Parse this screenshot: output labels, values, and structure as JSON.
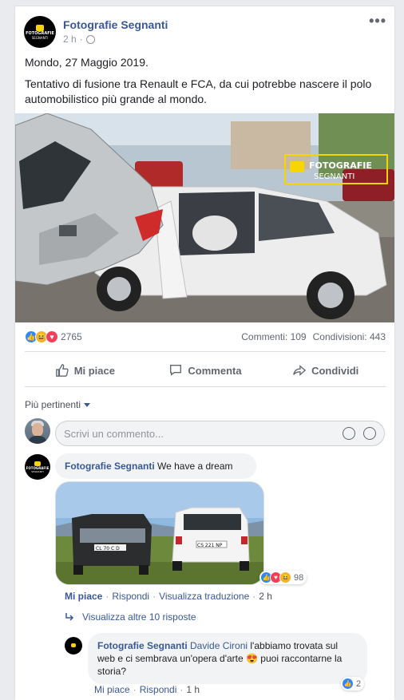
{
  "post": {
    "page_name": "Fotografie Segnanti",
    "time": "2 h",
    "date_line": "Mondo, 27 Maggio 2019.",
    "text": "Tentativo di fusione tra Renault e FCA, da cui potrebbe nascere il polo automobilistico più grande al mondo.",
    "logo_line1": "FOTOGRAFIE",
    "logo_line2": "SEGNANTI",
    "watermark_line1": "FOTOGRAFIE",
    "watermark_line2": "SEGNANTI"
  },
  "reactions": {
    "count": "2765",
    "comments": "Commenti: 109",
    "shares": "Condivisioni: 443",
    "icons": [
      "like-icon",
      "haha-icon",
      "love-icon"
    ]
  },
  "actions": {
    "like": "Mi piace",
    "comment": "Commenta",
    "share": "Condividi"
  },
  "comments": {
    "filter_label": "Più pertinenti",
    "input_placeholder": "Scrivi un commento...",
    "first": {
      "author": "Fotografie Segnanti",
      "text": "We have a dream",
      "like": "Mi piace",
      "reply": "Rispondi",
      "translate": "Visualizza traduzione",
      "time": "2 h",
      "reaction_count": "98",
      "plate_left": "CL 70 C D",
      "plate_right": "CS 221 NP"
    },
    "more_replies": "Visualizza altre 10 risposte",
    "reply": {
      "author": "Fotografie Segnanti",
      "mention": "Davide Cironi",
      "text": "l'abbiamo trovata sul web e ci sembrava un'opera d'arte 😍 puoi raccontarne la storia?",
      "like": "Mi piace",
      "reply": "Rispondi",
      "time": "1 h",
      "reaction_count": "2"
    }
  },
  "colors": {
    "link": "#385898",
    "like_blue": "#2d88ff",
    "love_red": "#f33e58",
    "haha_yellow": "#f7b125",
    "bg": "#e9ebee"
  }
}
